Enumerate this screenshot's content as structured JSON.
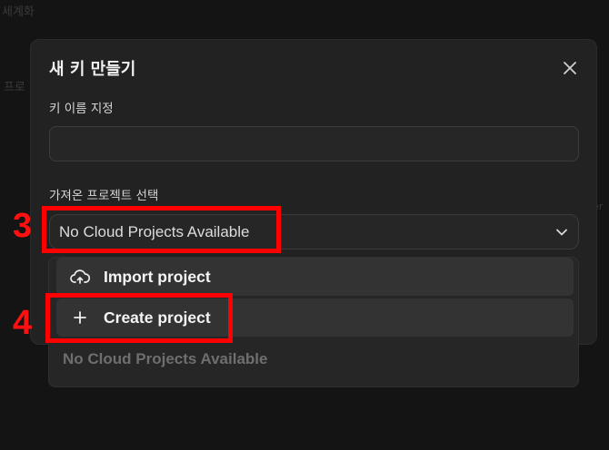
{
  "background": {
    "text_1": "세계화",
    "text_2": "프로",
    "text_3": "er"
  },
  "dialog": {
    "title": "새 키 만들기",
    "name_label": "키 이름 지정",
    "name_value": "",
    "project_label": "가져온 프로젝트 선택",
    "project_select_value": "No Cloud Projects Available"
  },
  "dropdown": {
    "items": [
      {
        "label": "Import project",
        "icon": "cloud-upload-icon"
      },
      {
        "label": "Create project",
        "icon": "plus-icon"
      }
    ],
    "empty_message": "No Cloud Projects Available"
  },
  "annotations": {
    "step_3": "3",
    "step_4": "4",
    "color": "#ff0000"
  }
}
